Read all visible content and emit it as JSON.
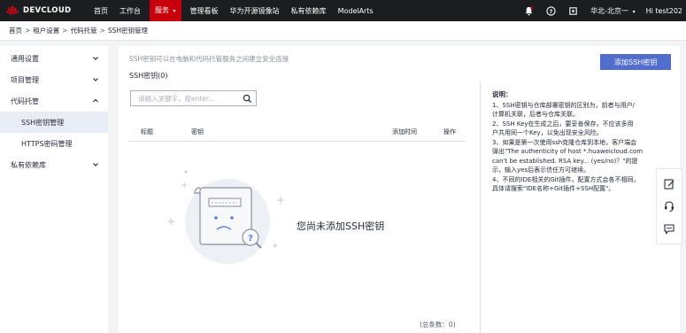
{
  "topbar": {
    "logo_text": "DEVCLOUD",
    "nav": [
      {
        "label": "首页"
      },
      {
        "label": "工作台"
      },
      {
        "label": "服务",
        "active": true
      },
      {
        "label": "管理看板"
      },
      {
        "label": "华为开源镜像站"
      },
      {
        "label": "私有依赖库"
      },
      {
        "label": "ModelArts"
      }
    ],
    "region": "华北-北京一",
    "user": "Hi test202"
  },
  "breadcrumb": [
    "首页",
    "租户设置",
    "代码托管",
    "SSH密钥管理"
  ],
  "sidebar": {
    "items": [
      {
        "label": "通用设置"
      },
      {
        "label": "项目管理"
      },
      {
        "label": "代码托管",
        "expanded": true,
        "children": [
          {
            "label": "SSH密钥管理",
            "active": true
          },
          {
            "label": "HTTPS密码管理"
          }
        ]
      },
      {
        "label": "私有依赖库"
      }
    ]
  },
  "main": {
    "description": "SSH密钥可以在电脑和代码托管服务之间建立安全连接",
    "count_label": "SSH密钥(0)",
    "add_button": "添加SSH密钥",
    "search_placeholder": "请输入关键字，按enter...",
    "table_headers": [
      "标题",
      "密钥",
      "添加时间",
      "操作"
    ],
    "empty_text": "您尚未添加SSH密钥",
    "total": "(总条数：0)"
  },
  "help": {
    "title": "说明：",
    "lines": [
      "1、SSH密钥与仓库部署密钥的区别为，前者与用户/",
      "计算机关联，后者与仓库关联。",
      "2、SSH Key在生成之后，要妥善保存，不应该多用",
      "户共用同一个Key，以免出现安全风险。",
      "3、如果是第一次使用ssh克隆仓库到本地，客户端会",
      "弹出\"The authenticity of host *.huaweicloud.com",
      "can't be established. RSA key... (yes/no)？\"的提",
      "示，输入yes后表示信任方可继续。",
      "4、不同的IDE相关的Git插件，配置方式会各不相同，",
      "具体请搜索\"IDE名称+Git插件+SSH配置\"。"
    ]
  },
  "colors": {
    "topbar_bg": "#1c1d21",
    "accent_red": "#c7000b",
    "primary_blue": "#526ecc"
  }
}
